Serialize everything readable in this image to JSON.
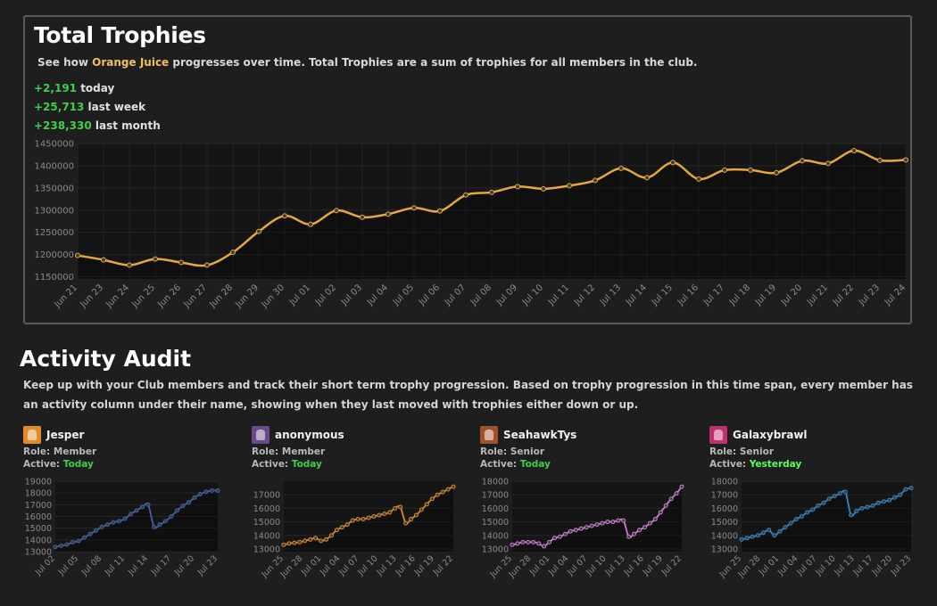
{
  "trophies": {
    "title": "Total Trophies",
    "desc_pre": "See how ",
    "club": "Orange Juice",
    "desc_post": " progresses over time. Total Trophies are a sum of trophies for all members in the club.",
    "stats": [
      {
        "value": "+2,191",
        "label": " today"
      },
      {
        "value": "+25,713",
        "label": " last week"
      },
      {
        "value": "+238,330",
        "label": " last month"
      }
    ]
  },
  "activity": {
    "title": "Activity Audit",
    "desc": "Keep up with your Club members and track their short term trophy progression. Based on trophy progression in this time span, every member has an activity column under their name, showing when they last moved with trophies either down or up.",
    "role_label": "Role: ",
    "active_label": "Active: ",
    "members": [
      {
        "name": "Jesper",
        "role": "Member",
        "active": "Today",
        "avatar_color": "#e08a2a"
      },
      {
        "name": "anonymous",
        "role": "Member",
        "active": "Today",
        "avatar_color": "#6a4a8a"
      },
      {
        "name": "SeahawkTys",
        "role": "Senior",
        "active": "Today",
        "avatar_color": "#a0522d"
      },
      {
        "name": "Galaxybrawl",
        "role": "Senior",
        "active": "Yesterday",
        "avatar_color": "#c03070"
      }
    ]
  },
  "colors": {
    "main_line": "#e6a83c",
    "jesper": "#3f63a8",
    "anonymous": "#d9872a",
    "seahawk": "#d079d8",
    "galaxy": "#2f86c8"
  },
  "chart_data": [
    {
      "type": "line",
      "title": "",
      "x": [
        "Jun 21",
        "Jun 23",
        "Jun 24",
        "Jun 25",
        "Jun 26",
        "Jun 27",
        "Jun 28",
        "Jun 29",
        "Jun 30",
        "Jul 01",
        "Jul 02",
        "Jul 03",
        "Jul 04",
        "Jul 05",
        "Jul 06",
        "Jul 07",
        "Jul 08",
        "Jul 09",
        "Jul 10",
        "Jul 11",
        "Jul 12",
        "Jul 13",
        "Jul 14",
        "Jul 15",
        "Jul 16",
        "Jul 17",
        "Jul 18",
        "Jul 19",
        "Jul 20",
        "Jul 21",
        "Jul 22",
        "Jul 23",
        "Jul 24"
      ],
      "series": [
        {
          "values": [
            1198000,
            1188000,
            1176000,
            1190000,
            1182000,
            1176000,
            1205000,
            1252000,
            1287000,
            1268000,
            1299000,
            1284000,
            1291000,
            1305000,
            1298000,
            1334000,
            1340000,
            1353000,
            1348000,
            1355000,
            1367000,
            1394000,
            1373000,
            1407000,
            1370000,
            1390000,
            1390000,
            1384000,
            1411000,
            1405000,
            1434000,
            1412000,
            1413000
          ]
        }
      ],
      "yticks": [
        1150000,
        1200000,
        1250000,
        1300000,
        1350000,
        1400000,
        1450000
      ],
      "ylim": [
        1145000,
        1450000
      ],
      "grid": true
    },
    {
      "type": "line",
      "title": "",
      "x": [
        "Jul 02",
        "Jul 05",
        "Jul 08",
        "Jul 11",
        "Jul 14",
        "Jul 17",
        "Jul 20",
        "Jul 23"
      ],
      "series": [
        {
          "values": [
            13400,
            13500,
            13600,
            13800,
            13900,
            14200,
            14500,
            14800,
            15100,
            15300,
            15500,
            15600,
            15800,
            16200,
            16500,
            16800,
            17000,
            15100,
            15300,
            15600,
            16000,
            16500,
            16900,
            17200,
            17600,
            17900,
            18100,
            18200,
            18200
          ]
        }
      ],
      "yticks": [
        13000,
        14000,
        15000,
        16000,
        17000,
        18000,
        19000
      ],
      "ylim": [
        13000,
        19000
      ]
    },
    {
      "type": "line",
      "title": "",
      "x": [
        "Jun 25",
        "Jun 28",
        "Jul 01",
        "Jul 04",
        "Jul 07",
        "Jul 10",
        "Jul 13",
        "Jul 16",
        "Jul 19",
        "Jul 22"
      ],
      "series": [
        {
          "values": [
            13300,
            13400,
            13450,
            13500,
            13600,
            13700,
            13800,
            13600,
            13700,
            14000,
            14400,
            14600,
            14800,
            15100,
            15200,
            15200,
            15300,
            15400,
            15500,
            15600,
            15700,
            16000,
            16100,
            14900,
            15200,
            15500,
            15900,
            16300,
            16700,
            17000,
            17200,
            17400,
            17600
          ]
        }
      ],
      "yticks": [
        13000,
        14000,
        15000,
        16000,
        17000
      ],
      "ylim": [
        12800,
        18000
      ]
    },
    {
      "type": "line",
      "title": "",
      "x": [
        "Jun 25",
        "Jun 28",
        "Jul 01",
        "Jul 04",
        "Jul 07",
        "Jul 10",
        "Jul 13",
        "Jul 16",
        "Jul 19",
        "Jul 22"
      ],
      "series": [
        {
          "values": [
            13300,
            13400,
            13500,
            13500,
            13500,
            13400,
            13200,
            13500,
            13800,
            13900,
            14100,
            14300,
            14400,
            14500,
            14600,
            14700,
            14800,
            14900,
            15000,
            15000,
            15100,
            15100,
            13900,
            14100,
            14400,
            14600,
            14900,
            15200,
            15700,
            16200,
            16700,
            17100,
            17600
          ]
        }
      ],
      "yticks": [
        13000,
        14000,
        15000,
        16000,
        17000,
        18000
      ],
      "ylim": [
        12800,
        18000
      ]
    },
    {
      "type": "line",
      "title": "",
      "x": [
        "Jun 25",
        "Jun 28",
        "Jul 01",
        "Jul 04",
        "Jul 07",
        "Jul 10",
        "Jul 13",
        "Jul 17",
        "Jul 20",
        "Jul 23"
      ],
      "series": [
        {
          "values": [
            13700,
            13800,
            13900,
            14000,
            14200,
            14400,
            14000,
            14300,
            14600,
            14900,
            15200,
            15400,
            15700,
            15900,
            16200,
            16400,
            16700,
            16900,
            17100,
            17200,
            15500,
            15800,
            16000,
            16100,
            16200,
            16400,
            16500,
            16600,
            16800,
            17000,
            17400,
            17500
          ]
        }
      ],
      "yticks": [
        13000,
        14000,
        15000,
        16000,
        17000,
        18000
      ],
      "ylim": [
        12800,
        18000
      ]
    }
  ]
}
